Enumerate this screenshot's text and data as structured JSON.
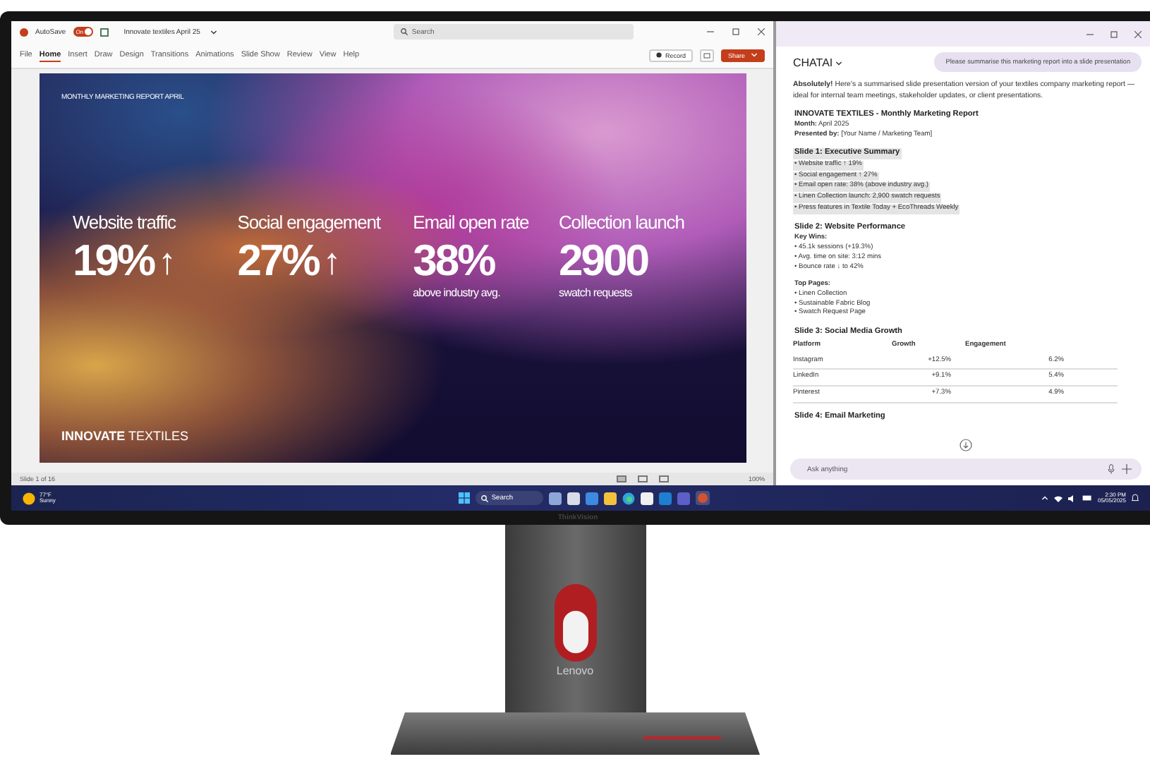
{
  "window": {
    "autosave_label": "AutoSave",
    "autosave_on": true,
    "autosave_state": "On",
    "doc_title": "Innovate textiles April 25",
    "search_placeholder": "Search"
  },
  "ribbon_tabs": [
    {
      "label": "File",
      "selected": false
    },
    {
      "label": "Home",
      "selected": true
    },
    {
      "label": "Insert",
      "selected": false
    },
    {
      "label": "Draw",
      "selected": false
    },
    {
      "label": "Design",
      "selected": false
    },
    {
      "label": "Transitions",
      "selected": false
    },
    {
      "label": "Animations",
      "selected": false
    },
    {
      "label": "Slide Show",
      "selected": false
    },
    {
      "label": "Review",
      "selected": false
    },
    {
      "label": "View",
      "selected": false
    },
    {
      "label": "Help",
      "selected": false
    }
  ],
  "ribbon_actions": {
    "record": "Record",
    "share": "Share"
  },
  "slide": {
    "header": "MONTHLY MARKETING REPORT APRIL",
    "stats": [
      {
        "label": "Website traffic",
        "value": "19%",
        "arrow": "↑"
      },
      {
        "label": "Social engagement",
        "value": "27%",
        "arrow": "↑"
      },
      {
        "label": "Email open rate",
        "value": "38%",
        "note": "above industry avg."
      },
      {
        "label": "Collection launch",
        "value": "2900",
        "note": "swatch requests"
      }
    ],
    "brand": "**INNOVATE** TEXTILES"
  },
  "status_bar": {
    "slide_position": "Slide 1 of 16",
    "zoom": "100%"
  },
  "chat": {
    "model": "CHATAI",
    "user_message": "Please summarise this marketing report into a slide presentation",
    "intro": "**Absolutely!** Here’s a summarised slide presentation version of your textiles company marketing report — ideal for internal team meetings, stakeholder updates, or client presentations.",
    "report_title": "INNOVATE TEXTILES - Monthly Marketing Report",
    "meta": [
      "**Month:** April 2025",
      "**Presented by:** [Your Name / Marketing Team]"
    ],
    "sections": [
      {
        "kind": "list",
        "title": "Slide 1: Executive Summary",
        "highlighted": true,
        "groups": [
          {
            "items": [
              "• Website traffic ↑ 19%",
              "• Social engagement ↑ 27%",
              "• Email open rate: 38% (above industry avg.)",
              "• Linen Collection launch: 2,900 swatch requests",
              "• Press features in Textile Today + EcoThreads Weekly"
            ]
          }
        ]
      },
      {
        "kind": "list",
        "title": "Slide 2: Website Performance",
        "highlighted": false,
        "groups": [
          {
            "heading": "Key Wins:",
            "items": [
              "• 45.1k sessions (+19.3%)",
              "• Avg. time on site: 3:12 mins",
              "• Bounce rate ↓ to 42%"
            ]
          },
          {
            "heading": "Top Pages:",
            "items": [
              "• Linen Collection",
              "• Sustainable Fabric Blog",
              "• Swatch Request Page"
            ]
          }
        ]
      },
      {
        "kind": "table",
        "title": "Slide 3: Social Media Growth",
        "highlighted": false,
        "columns": [
          "Platform",
          "Growth",
          "Engagement"
        ],
        "rows": [
          [
            "Instagram",
            "+12.5%",
            "6.2%"
          ],
          [
            "LinkedIn",
            "+9.1%",
            "5.4%"
          ],
          [
            "Pinterest",
            "+7.3%",
            "4.9%"
          ]
        ]
      },
      {
        "kind": "list",
        "title": "Slide 4: Email Marketing",
        "highlighted": false
      }
    ],
    "input_placeholder": "Ask anything"
  },
  "taskbar": {
    "temperature": "77°F",
    "condition": "Sunny",
    "search": "Search",
    "time": "2:30 PM",
    "date": "05/05/2025"
  },
  "monitor": {
    "bezel_brand": "ThinkVision",
    "stand_brand": "Lenovo"
  }
}
